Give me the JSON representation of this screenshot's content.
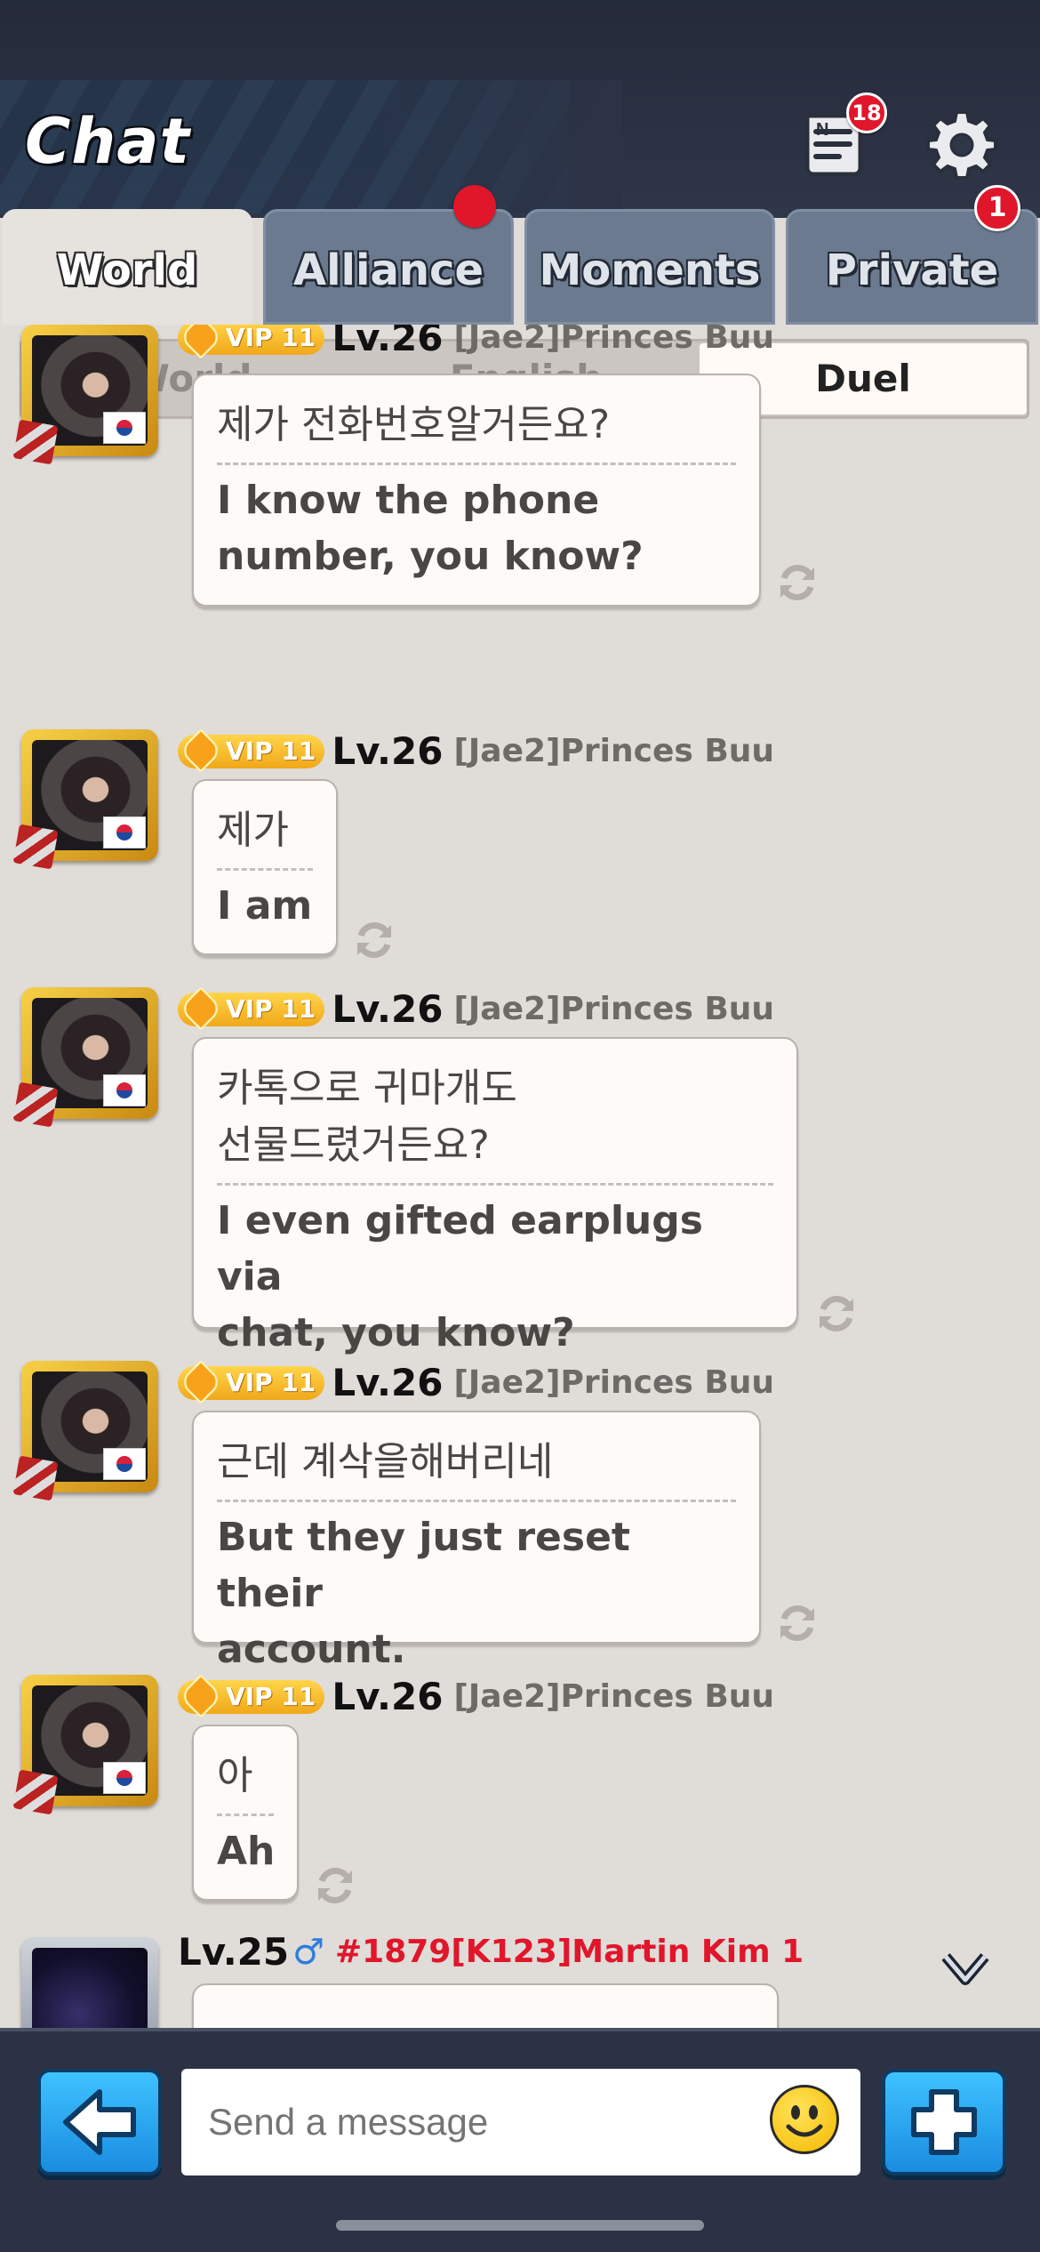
{
  "header": {
    "title": "Chat",
    "news_badge": "18",
    "colors": {
      "badge": "#e0162b",
      "header_bg": "#252a3a"
    }
  },
  "tabs": [
    {
      "label": "World",
      "active": true
    },
    {
      "label": "Alliance",
      "active": false,
      "dot": true
    },
    {
      "label": "Moments",
      "active": false
    },
    {
      "label": "Private",
      "active": false,
      "badge": "1"
    }
  ],
  "subtabs": [
    {
      "label": "World",
      "active": false
    },
    {
      "label": "English",
      "active": false
    },
    {
      "label": "Duel",
      "active": true
    }
  ],
  "messages": [
    {
      "vip": "VIP 11",
      "level": "Lv.26",
      "name": "[Jae2]Princes Buu",
      "original": [
        "제가 전화번호알거든요?"
      ],
      "translation": [
        "I know the phone",
        "number, you know?"
      ]
    },
    {
      "vip": "VIP 11",
      "level": "Lv.26",
      "name": "[Jae2]Princes Buu",
      "original": [
        "제가"
      ],
      "translation": [
        "I am"
      ]
    },
    {
      "vip": "VIP 11",
      "level": "Lv.26",
      "name": "[Jae2]Princes Buu",
      "original": [
        "카톡으로 귀마개도",
        "선물드렸거든요?"
      ],
      "translation": [
        "I even gifted earplugs via",
        "chat, you know?"
      ]
    },
    {
      "vip": "VIP 11",
      "level": "Lv.26",
      "name": "[Jae2]Princes Buu",
      "original": [
        "근데 계삭을해버리네"
      ],
      "translation": [
        "But they just reset their",
        "account."
      ]
    },
    {
      "vip": "VIP 11",
      "level": "Lv.26",
      "name": "[Jae2]Princes Buu",
      "original": [
        "아"
      ],
      "translation": [
        "Ah"
      ]
    }
  ],
  "last_message": {
    "level": "Lv.25",
    "gender_icon": "male-icon",
    "name": "#1879[K123]Martin Kim 1"
  },
  "composer": {
    "placeholder": "Send a message"
  }
}
